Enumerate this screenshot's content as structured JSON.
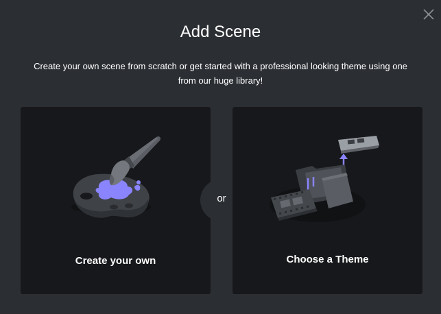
{
  "dialog": {
    "title": "Add Scene",
    "subtitle": "Create your own scene from scratch or get started with a professional looking theme using one from our huge library!",
    "close_icon": "close-icon"
  },
  "options": {
    "create_own": {
      "label": "Create your own",
      "icon": "paint-palette-icon"
    },
    "separator": "or",
    "choose_theme": {
      "label": "Choose a Theme",
      "icon": "theme-folder-icon"
    }
  },
  "colors": {
    "background": "#2b2e33",
    "card": "#17181b",
    "accent": "#8a84ff",
    "text": "#ffffff"
  }
}
